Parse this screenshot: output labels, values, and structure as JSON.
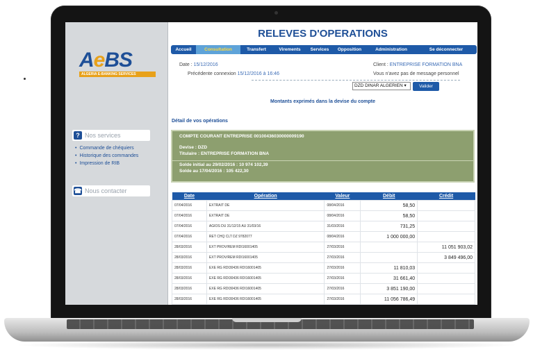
{
  "app": {
    "title": "RELEVES D'OPERATIONS",
    "logo": "AEBS",
    "logo_tag": "ALGERIA E-BANKING SERVICES"
  },
  "nav": {
    "items": [
      "Accueil",
      "Consultation",
      "Transfert",
      "Virements",
      "Services",
      "Opposition",
      "Administration",
      "Se déconnecter"
    ],
    "active": "Consultation"
  },
  "info": {
    "date_label": "Date :",
    "date_value": "15/12/2016",
    "prev_label": "Précédente connexion",
    "prev_value": "15/12/2016 à 16:46",
    "client_label": "Client :",
    "client_value": "ENTREPRISE FORMATION BNA",
    "messages": "Vous n'avez pas de message personnel"
  },
  "currency": {
    "selected": "DZD DINAR ALGERIEN ▾",
    "submit": "Valider",
    "note": "Montants exprimés dans la devise du compte"
  },
  "detail_heading": "Détail de vos opérations",
  "account": {
    "title": "COMPTE COURANT ENTREPRISE 00100436030000009190",
    "devise": "Devise : DZD",
    "titulaire": "Titulaire : ENTREPRISE FORMATION BNA",
    "solde_initial": "Solde initial au 29/02/2016 : 10 974 102,39",
    "solde_final": "Solde au 17/04/2016 : 105 422,30"
  },
  "sidebar": {
    "services_title": "Nos services",
    "services": [
      "Commande de chéquiers",
      "Historique des commandes",
      "Impression de RIB"
    ],
    "contact_title": "Nous contacter"
  },
  "table": {
    "headers": [
      "Date",
      "Opération",
      "Valeur",
      "Débit",
      "Crédit"
    ],
    "rows": [
      [
        "07/04/2016",
        "EXTRAIT DE",
        "08/04/2016",
        "58,50",
        ""
      ],
      [
        "07/04/2016",
        "EXTRAIT DE",
        "08/04/2016",
        "58,50",
        ""
      ],
      [
        "07/04/2016",
        "AGIOS DU 31/12/15 AU 31/03/16",
        "31/03/2016",
        "731,25",
        ""
      ],
      [
        "07/04/2016",
        "RET CHQ CLT DZ 9782077",
        "08/04/2016",
        "1 000 000,00",
        ""
      ],
      [
        "28/03/2016",
        "EXT PROV/REM RDI16001405",
        "27/03/2016",
        "",
        "11 051 903,02"
      ],
      [
        "28/03/2016",
        "EXT PROV/REM RDI16001405",
        "27/03/2016",
        "",
        "3 849 496,00"
      ],
      [
        "28/03/2016",
        "EXE RG RDI30436 RDI16001405",
        "27/03/2016",
        "11 810,03",
        ""
      ],
      [
        "28/03/2016",
        "EXE RG RDI30436 RDI16001405",
        "27/03/2016",
        "31 661,40",
        ""
      ],
      [
        "28/03/2016",
        "EXE RG RDI30436 RDI16001405",
        "27/03/2016",
        "3 851 190,00",
        ""
      ],
      [
        "28/03/2016",
        "EXE RG RDI30436 RDI16001405",
        "27/03/2016",
        "11 056 786,49",
        ""
      ]
    ]
  }
}
